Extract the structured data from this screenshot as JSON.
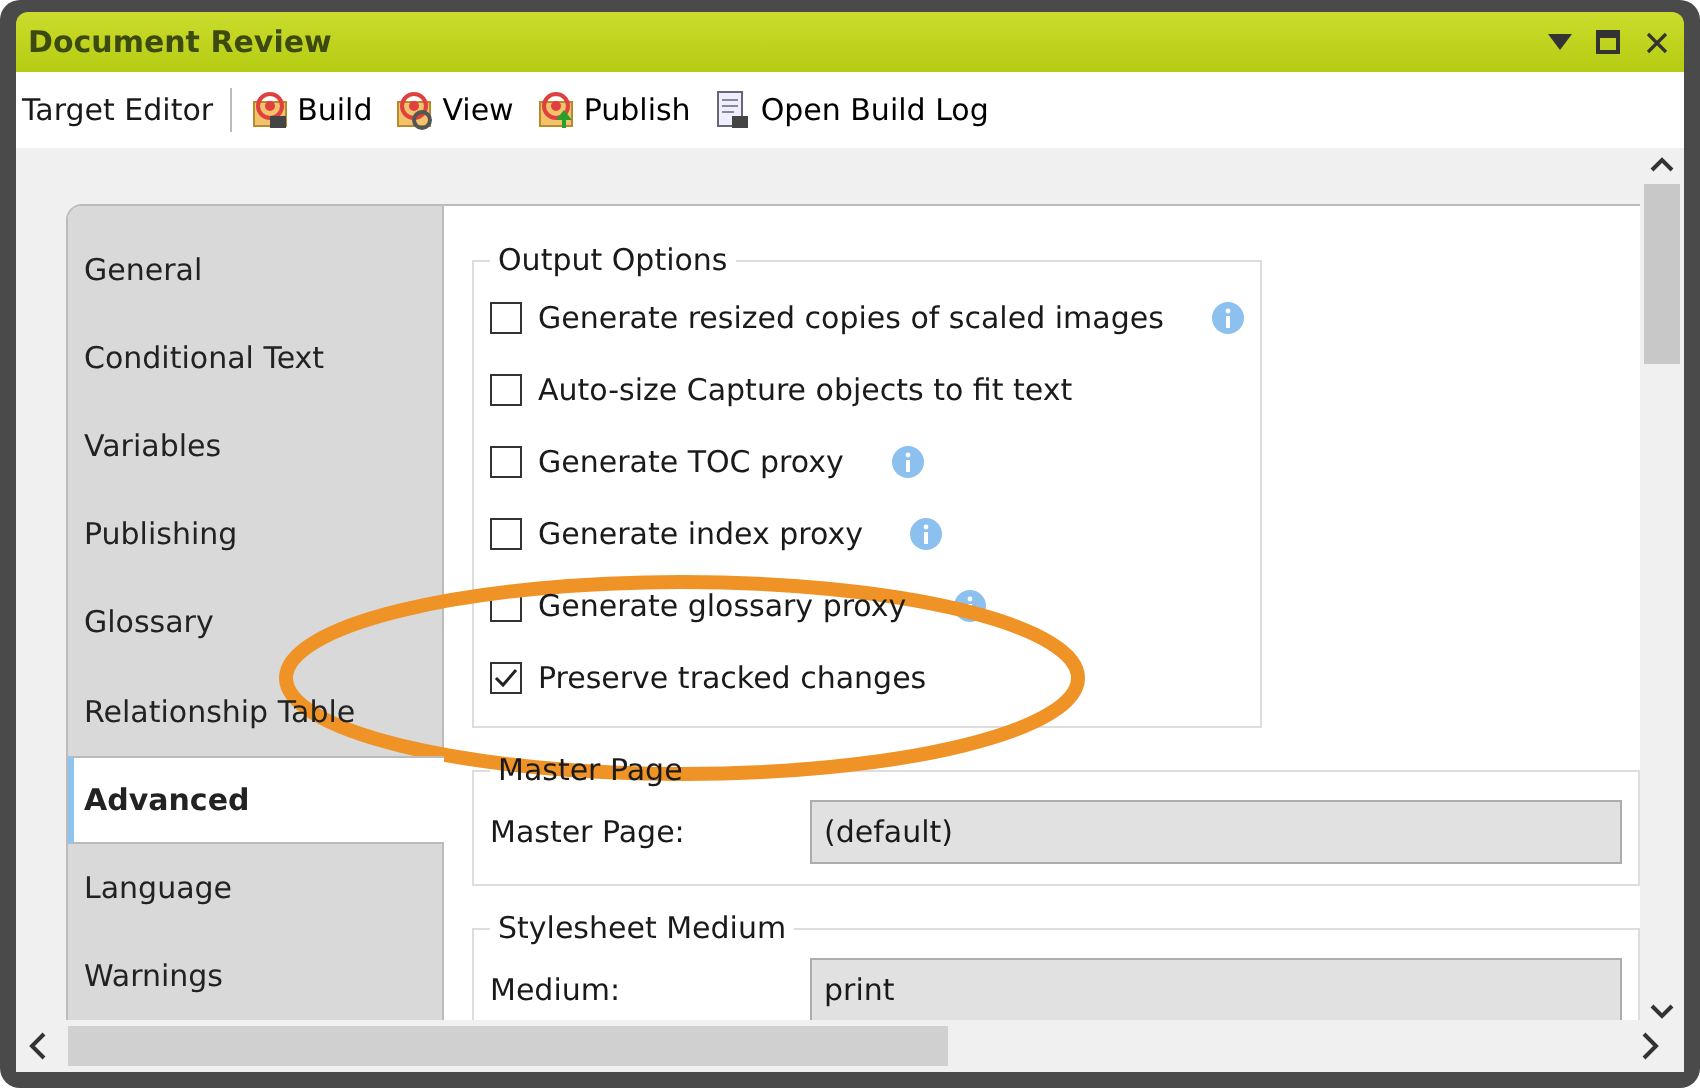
{
  "window": {
    "title": "Document Review"
  },
  "toolbar": {
    "label": "Target Editor",
    "buttons": [
      {
        "label": "Build",
        "kind": "build"
      },
      {
        "label": "View",
        "kind": "view"
      },
      {
        "label": "Publish",
        "kind": "publish"
      },
      {
        "label": "Open Build Log",
        "kind": "log"
      }
    ]
  },
  "tabs": [
    {
      "label": "General",
      "selected": false
    },
    {
      "label": "Conditional Text",
      "selected": false
    },
    {
      "label": "Variables",
      "selected": false
    },
    {
      "label": "Publishing",
      "selected": false
    },
    {
      "label": "Glossary",
      "selected": false
    },
    {
      "label": "Relationship Table",
      "selected": false
    },
    {
      "label": "Advanced",
      "selected": true
    },
    {
      "label": "Language",
      "selected": false
    },
    {
      "label": "Warnings",
      "selected": false
    }
  ],
  "output_options": {
    "title": "Output Options",
    "options": [
      {
        "label": "Generate resized copies of scaled images",
        "checked": false,
        "info": true
      },
      {
        "label": "Auto-size Capture objects to fit text",
        "checked": false,
        "info": false
      },
      {
        "label": "Generate TOC proxy",
        "checked": false,
        "info": true
      },
      {
        "label": "Generate index proxy",
        "checked": false,
        "info": true
      },
      {
        "label": "Generate glossary proxy",
        "checked": false,
        "info": true
      },
      {
        "label": "Preserve tracked changes",
        "checked": true,
        "info": false
      }
    ]
  },
  "master_page": {
    "title": "Master Page",
    "label": "Master Page:",
    "value": "(default)"
  },
  "stylesheet_medium": {
    "title": "Stylesheet Medium",
    "label": "Medium:",
    "value": "print"
  }
}
